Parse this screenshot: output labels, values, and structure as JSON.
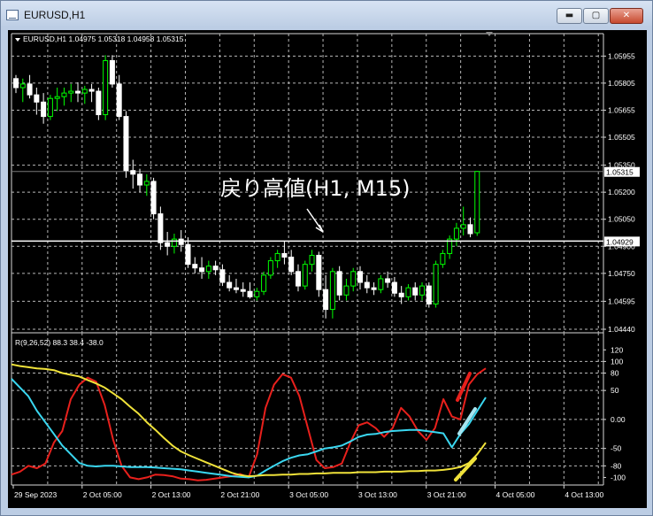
{
  "window": {
    "title": "EURUSD,H1",
    "buttons": {
      "minimize": "▬",
      "maximize": "▢",
      "close": "✕"
    }
  },
  "price_pane": {
    "header": "EURUSD,H1  1.04975 1.05318 1.04958 1.05315",
    "annotation": "戻り高値(H1, M15)",
    "current_price_label": "1.05315",
    "hline_price_label": "1.04929",
    "hline_price": 1.04929,
    "price_ticks": [
      "1.05955",
      "1.05805",
      "1.05655",
      "1.05505",
      "1.05350",
      "1.05200",
      "1.05050",
      "1.04900",
      "1.04750",
      "1.04595",
      "1.04440"
    ],
    "colors": {
      "up": "#00ff00",
      "down": "#ffffff",
      "hline": "#ffffff"
    }
  },
  "indicator_pane": {
    "header": "R(9,26,52) 88.3 38.4 -38.0",
    "ticks": [
      "120",
      "100",
      "80",
      "50",
      "0.00",
      "-50",
      "-80",
      "-100"
    ],
    "colors": {
      "fast": "#e8201c",
      "mid": "#3ad7f0",
      "slow": "#f0e23a"
    }
  },
  "x_axis": {
    "labels": [
      "29 Sep 2023",
      "2 Oct 05:00",
      "2 Oct 13:00",
      "2 Oct 21:00",
      "3 Oct 05:00",
      "3 Oct 13:00",
      "3 Oct 21:00",
      "4 Oct 05:00",
      "4 Oct 13:00"
    ]
  },
  "chart_data": [
    {
      "type": "candlestick",
      "title": "EURUSD,H1",
      "ylim": [
        1.0444,
        1.0605
      ],
      "candles": [
        [
          1.0583,
          1.0585,
          1.0575,
          1.0578
        ],
        [
          1.0578,
          1.0583,
          1.057,
          1.058
        ],
        [
          1.058,
          1.0585,
          1.0572,
          1.0574
        ],
        [
          1.0574,
          1.0578,
          1.0563,
          1.057
        ],
        [
          1.057,
          1.0575,
          1.0558,
          1.0562
        ],
        [
          1.0562,
          1.0574,
          1.056,
          1.0572
        ],
        [
          1.0572,
          1.0578,
          1.0565,
          1.0573
        ],
        [
          1.0573,
          1.0578,
          1.0568,
          1.0575
        ],
        [
          1.0575,
          1.058,
          1.057,
          1.0576
        ],
        [
          1.0576,
          1.0581,
          1.057,
          1.0575
        ],
        [
          1.0575,
          1.0579,
          1.0569,
          1.0577
        ],
        [
          1.0577,
          1.058,
          1.057,
          1.0576
        ],
        [
          1.0576,
          1.0578,
          1.056,
          1.0563
        ],
        [
          1.0563,
          1.0596,
          1.056,
          1.0593
        ],
        [
          1.0593,
          1.0596,
          1.0578,
          1.058
        ],
        [
          1.058,
          1.0585,
          1.056,
          1.0562
        ],
        [
          1.0562,
          1.0565,
          1.0528,
          1.0532
        ],
        [
          1.0532,
          1.0538,
          1.0522,
          1.053
        ],
        [
          1.053,
          1.0533,
          1.052,
          1.0524
        ],
        [
          1.0524,
          1.053,
          1.0518,
          1.0526
        ],
        [
          1.0526,
          1.0528,
          1.0505,
          1.0508
        ],
        [
          1.0508,
          1.0512,
          1.0488,
          1.0492
        ],
        [
          1.0492,
          1.0498,
          1.0485,
          1.049
        ],
        [
          1.049,
          1.0497,
          1.0486,
          1.0494
        ],
        [
          1.0494,
          1.0499,
          1.0487,
          1.0491
        ],
        [
          1.0491,
          1.0495,
          1.0478,
          1.048
        ],
        [
          1.048,
          1.0484,
          1.0475,
          1.0478
        ],
        [
          1.0478,
          1.0484,
          1.0472,
          1.0476
        ],
        [
          1.0476,
          1.0482,
          1.0472,
          1.0479
        ],
        [
          1.0479,
          1.0482,
          1.0474,
          1.0477
        ],
        [
          1.0477,
          1.048,
          1.0468,
          1.047
        ],
        [
          1.047,
          1.0474,
          1.0465,
          1.0467
        ],
        [
          1.0467,
          1.0472,
          1.0464,
          1.0466
        ],
        [
          1.0466,
          1.047,
          1.0462,
          1.0465
        ],
        [
          1.0465,
          1.047,
          1.0461,
          1.0462
        ],
        [
          1.0462,
          1.0467,
          1.046,
          1.0465
        ],
        [
          1.0465,
          1.0476,
          1.0463,
          1.0474
        ],
        [
          1.0474,
          1.0484,
          1.0472,
          1.0482
        ],
        [
          1.0482,
          1.0488,
          1.0478,
          1.0486
        ],
        [
          1.0486,
          1.0493,
          1.048,
          1.0484
        ],
        [
          1.0484,
          1.0488,
          1.0474,
          1.0476
        ],
        [
          1.0476,
          1.048,
          1.0465,
          1.0468
        ],
        [
          1.0468,
          1.0482,
          1.0466,
          1.048
        ],
        [
          1.048,
          1.0488,
          1.0476,
          1.0485
        ],
        [
          1.0485,
          1.0487,
          1.0462,
          1.0466
        ],
        [
          1.0466,
          1.0474,
          1.045,
          1.0455
        ],
        [
          1.0455,
          1.0478,
          1.045,
          1.0476
        ],
        [
          1.0476,
          1.0479,
          1.046,
          1.0463
        ],
        [
          1.0463,
          1.0472,
          1.046,
          1.0468
        ],
        [
          1.0468,
          1.0478,
          1.0465,
          1.0476
        ],
        [
          1.0476,
          1.0479,
          1.0466,
          1.047
        ],
        [
          1.047,
          1.0474,
          1.0464,
          1.0467
        ],
        [
          1.0467,
          1.047,
          1.0463,
          1.0466
        ],
        [
          1.0466,
          1.0474,
          1.0464,
          1.0472
        ],
        [
          1.0472,
          1.0476,
          1.0467,
          1.047
        ],
        [
          1.047,
          1.0473,
          1.0462,
          1.0464
        ],
        [
          1.0464,
          1.0468,
          1.0458,
          1.0462
        ],
        [
          1.0462,
          1.0469,
          1.046,
          1.0467
        ],
        [
          1.0467,
          1.047,
          1.046,
          1.0463
        ],
        [
          1.0463,
          1.047,
          1.046,
          1.0468
        ],
        [
          1.0468,
          1.047,
          1.0456,
          1.0458
        ],
        [
          1.0458,
          1.0482,
          1.0456,
          1.048
        ],
        [
          1.048,
          1.0488,
          1.0478,
          1.0486
        ],
        [
          1.0486,
          1.0496,
          1.0483,
          1.0494
        ],
        [
          1.0494,
          1.0503,
          1.049,
          1.05
        ],
        [
          1.05,
          1.0512,
          1.0496,
          1.0502
        ],
        [
          1.0502,
          1.0506,
          1.0495,
          1.0497
        ],
        [
          1.04975,
          1.05318,
          1.04958,
          1.05315
        ]
      ]
    },
    {
      "type": "line",
      "title": "R(9,26,52) 88.3 38.4 -38.0",
      "ylim": [
        -110,
        125
      ],
      "series": [
        {
          "values": [
            -95,
            -90,
            -80,
            -84,
            -76,
            -40,
            -20,
            35,
            60,
            72,
            65,
            25,
            -35,
            -80,
            -100,
            -103,
            -100,
            -95,
            -96,
            -98,
            -102,
            -103,
            -105,
            -104,
            -102,
            -100,
            -98,
            -94,
            -100,
            -60,
            20,
            60,
            78,
            72,
            40,
            -15,
            -70,
            -84,
            -82,
            -76,
            -40,
            -10,
            -5,
            -15,
            -30,
            -15,
            20,
            5,
            -20,
            -35,
            -15,
            35,
            5,
            0,
            60,
            78,
            88
          ]
        },
        {
          "values": [
            70,
            55,
            40,
            15,
            -5,
            -25,
            -45,
            -60,
            -75,
            -80,
            -81,
            -80,
            -80,
            -81,
            -82,
            -82,
            -82,
            -83,
            -84,
            -85,
            -86,
            -88,
            -90,
            -92,
            -94,
            -96,
            -98,
            -99,
            -100,
            -97,
            -88,
            -80,
            -72,
            -66,
            -62,
            -60,
            -55,
            -50,
            -48,
            -45,
            -38,
            -30,
            -26,
            -25,
            -22,
            -20,
            -19,
            -18,
            -18,
            -20,
            -22,
            -24,
            -48,
            -25,
            -8,
            15,
            38
          ]
        },
        {
          "values": [
            95,
            92,
            90,
            88,
            87,
            85,
            80,
            77,
            74,
            68,
            62,
            55,
            45,
            35,
            22,
            10,
            -5,
            -18,
            -32,
            -45,
            -55,
            -62,
            -68,
            -74,
            -80,
            -86,
            -92,
            -96,
            -98,
            -97,
            -96,
            -96,
            -95,
            -95,
            -94,
            -94,
            -93,
            -93,
            -92,
            -92,
            -92,
            -91,
            -91,
            -91,
            -90,
            -90,
            -90,
            -89,
            -89,
            -88,
            -88,
            -87,
            -85,
            -82,
            -75,
            -60,
            -40
          ]
        }
      ]
    }
  ]
}
